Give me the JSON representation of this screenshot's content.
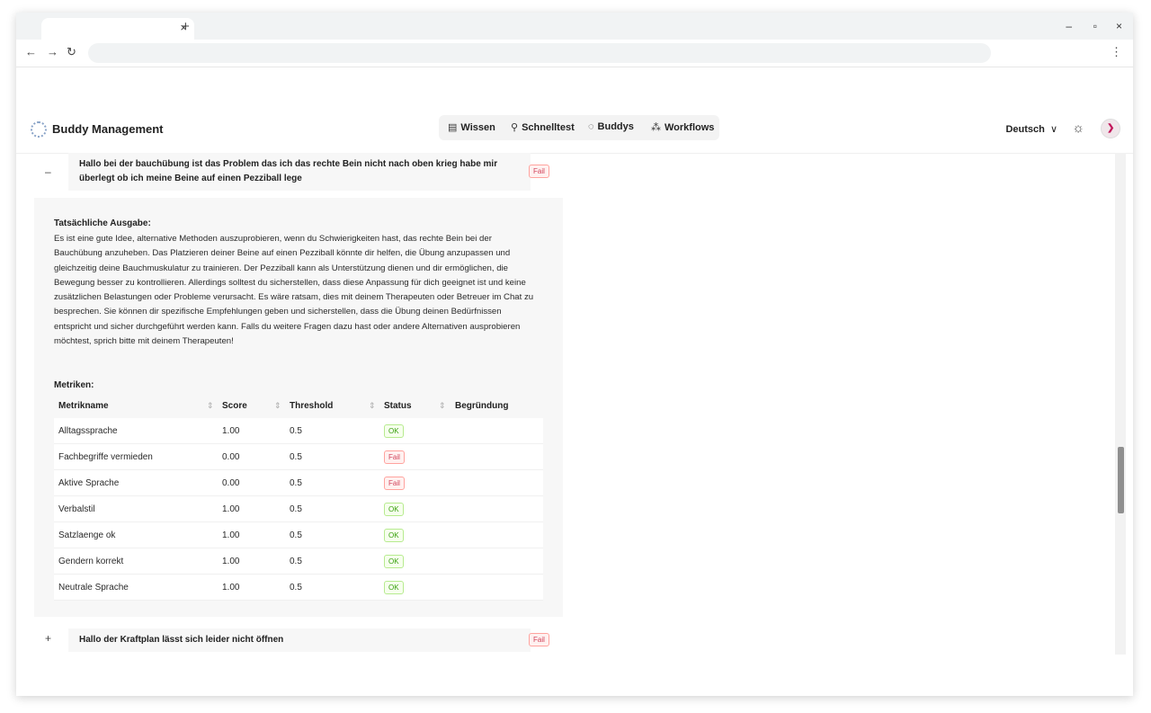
{
  "browser": {
    "tab_close": "×",
    "tab_new": "+",
    "nav_back": "←",
    "nav_forward": "→",
    "nav_reload": "↻",
    "menu": "⋮",
    "window_controls": [
      "–",
      "▫",
      "×"
    ]
  },
  "header": {
    "brand": "Buddy Management",
    "nav": [
      {
        "label": "Wissen",
        "icon": "database-icon"
      },
      {
        "label": "Schnelltest",
        "icon": "search-icon"
      },
      {
        "label": "Buddys",
        "icon": "chat-bubble-icon"
      },
      {
        "label": "Workflows",
        "icon": "workflow-icon"
      }
    ],
    "language": "Deutsch",
    "language_caret": "∨"
  },
  "items": [
    {
      "toggle": "–",
      "title": "Hallo bei der bauchübung ist das Problem das ich das rechte Bein nicht nach oben krieg habe mir überlegt ob ich meine Beine auf einen Pezziball lege",
      "status": "Fail",
      "expanded": true,
      "output_label": "Tatsächliche Ausgabe:",
      "output_text": "Es ist eine gute Idee, alternative Methoden auszuprobieren, wenn du Schwierigkeiten hast, das rechte Bein bei der Bauchübung anzuheben. Das Platzieren deiner Beine auf einen Pezziball könnte dir helfen, die Übung anzupassen und gleichzeitig deine Bauchmuskulatur zu trainieren. Der Pezziball kann als Unterstützung dienen und dir ermöglichen, die Bewegung besser zu kontrollieren. Allerdings solltest du sicherstellen, dass diese Anpassung für dich geeignet ist und keine zusätzlichen Belastungen oder Probleme verursacht. Es wäre ratsam, dies mit deinem Therapeuten oder Betreuer im Chat zu besprechen. Sie können dir spezifische Empfehlungen geben und sicherstellen, dass die Übung deinen Bedürfnissen entspricht und sicher durchgeführt werden kann. Falls du weitere Fragen dazu hast oder andere Alternativen ausprobieren möchtest, sprich bitte mit deinem Therapeuten!",
      "metrics_label": "Metriken:",
      "columns": [
        "Metrikname",
        "Score",
        "Threshold",
        "Status",
        "Begründung"
      ],
      "metrics": [
        {
          "name": "Alltagssprache",
          "score": "1.00",
          "threshold": "0.5",
          "status": "OK",
          "reason": ""
        },
        {
          "name": "Fachbegriffe vermieden",
          "score": "0.00",
          "threshold": "0.5",
          "status": "Fail",
          "reason": ""
        },
        {
          "name": "Aktive Sprache",
          "score": "0.00",
          "threshold": "0.5",
          "status": "Fail",
          "reason": ""
        },
        {
          "name": "Verbalstil",
          "score": "1.00",
          "threshold": "0.5",
          "status": "OK",
          "reason": ""
        },
        {
          "name": "Satzlaenge ok",
          "score": "1.00",
          "threshold": "0.5",
          "status": "OK",
          "reason": ""
        },
        {
          "name": "Gendern korrekt",
          "score": "1.00",
          "threshold": "0.5",
          "status": "OK",
          "reason": ""
        },
        {
          "name": "Neutrale Sprache",
          "score": "1.00",
          "threshold": "0.5",
          "status": "OK",
          "reason": ""
        }
      ]
    },
    {
      "toggle": "+",
      "title": "Hallo der Kraftplan lässt sich leider nicht öffnen",
      "status": "Fail",
      "expanded": false
    }
  ],
  "colors": {
    "fail": "#d1435b",
    "ok": "#389e0d",
    "panel_bg": "#f7f7f7"
  }
}
